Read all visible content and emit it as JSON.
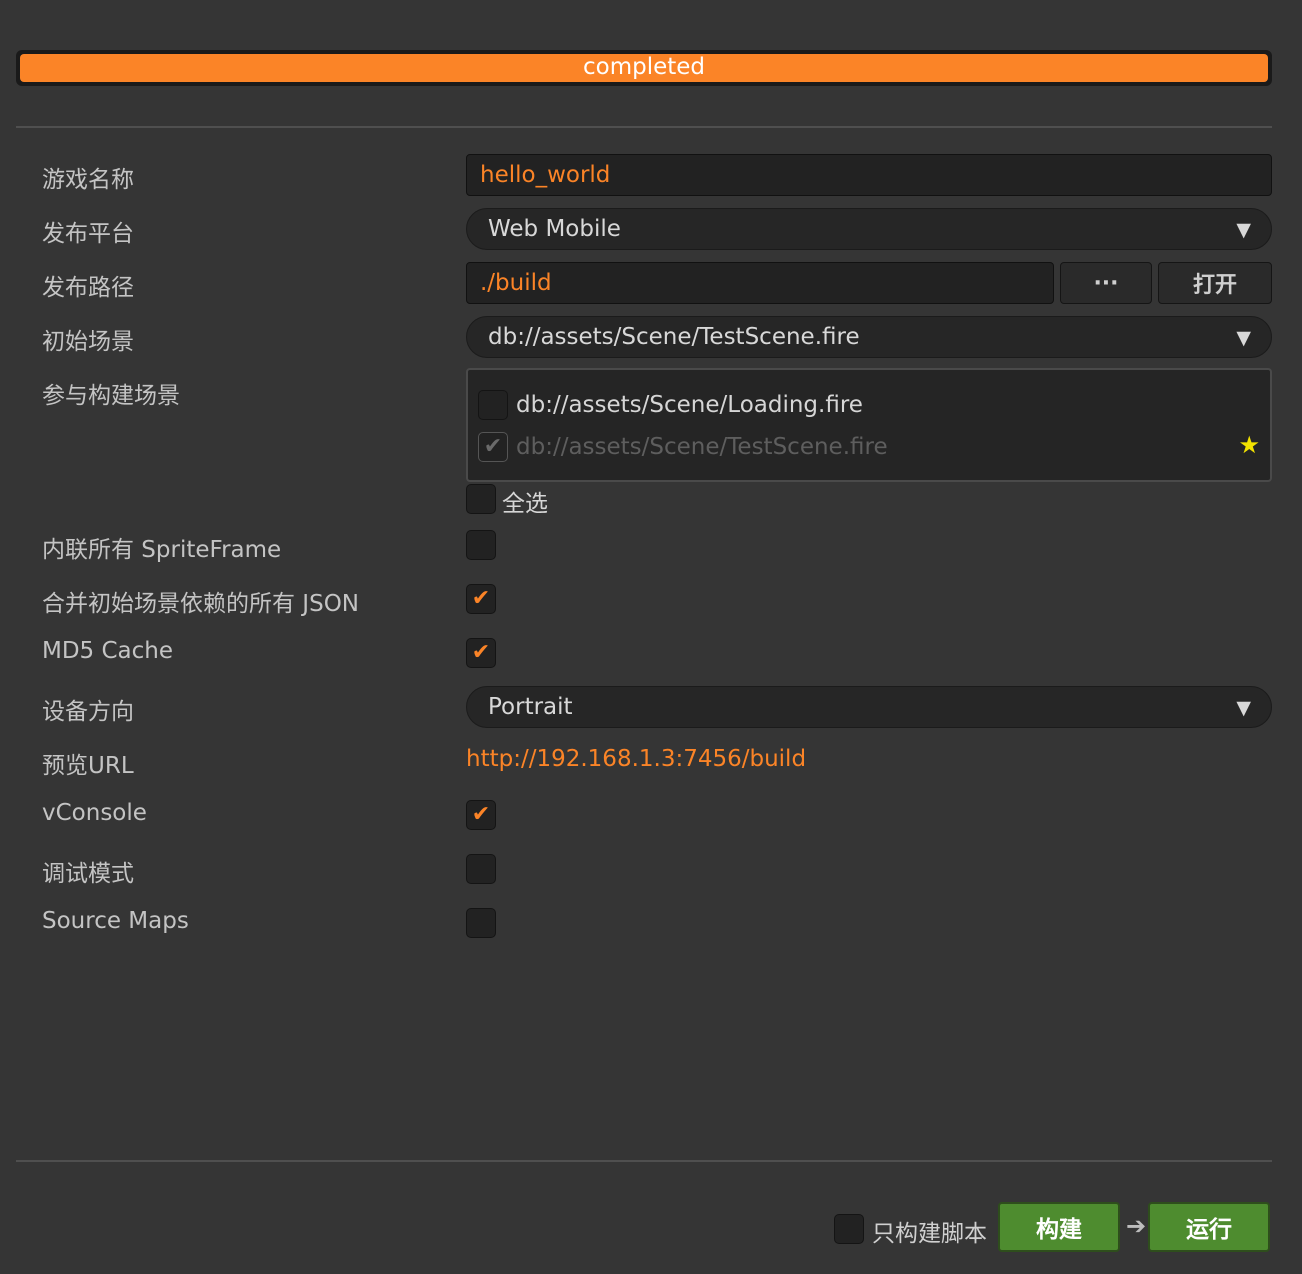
{
  "progress": {
    "status": "completed",
    "percent": 100
  },
  "labels": {
    "game_name": "游戏名称",
    "platform": "发布平台",
    "build_path": "发布路径",
    "start_scene": "初始场景",
    "included_scenes": "参与构建场景",
    "inline_spriteframe": "内联所有 SpriteFrame",
    "merge_json": "合并初始场景依赖的所有 JSON",
    "md5_cache": "MD5 Cache",
    "orientation": "设备方向",
    "preview_url": "预览URL",
    "vconsole": "vConsole",
    "debug_mode": "调试模式",
    "source_maps": "Source Maps"
  },
  "values": {
    "game_name": "hello_world",
    "platform": "Web Mobile",
    "build_path": "./build",
    "browse_button": "···",
    "open_button": "打开",
    "start_scene": "db://assets/Scene/TestScene.fire",
    "orientation": "Portrait",
    "preview_url": "http://192.168.1.3:7456/build"
  },
  "scenes": [
    {
      "path": "db://assets/Scene/Loading.fire",
      "checked": false,
      "disabled": false,
      "is_start": false
    },
    {
      "path": "db://assets/Scene/TestScene.fire",
      "checked": true,
      "disabled": true,
      "is_start": true
    }
  ],
  "select_all_label": "全选",
  "checkboxes": {
    "select_all": false,
    "inline_spriteframe": false,
    "merge_json": true,
    "md5_cache": true,
    "vconsole": true,
    "debug_mode": false,
    "source_maps": false,
    "script_only": false
  },
  "footer": {
    "script_only_label": "只构建脚本",
    "build_button": "构建",
    "run_button": "运行"
  },
  "icons": {
    "dropdown": "triangle-down-icon",
    "star": "star-icon",
    "check": "check-icon",
    "arrow": "arrow-right-icon"
  },
  "colors": {
    "accent": "#fb8427",
    "background": "#353535",
    "build_button": "#4e8c2f",
    "star": "#f2e200"
  }
}
